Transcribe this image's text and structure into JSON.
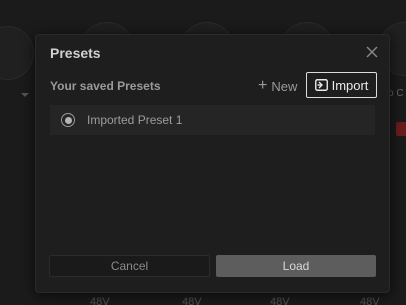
{
  "dialog": {
    "title": "Presets",
    "subheader": "Your saved Presets",
    "new_label": "New",
    "import_label": "Import",
    "presets": [
      {
        "label": "Imported Preset 1",
        "selected": true
      }
    ],
    "cancel_label": "Cancel",
    "load_label": "Load"
  },
  "background": {
    "phantom_labels": [
      "48V",
      "48V",
      "48V",
      "48V"
    ]
  },
  "colors": {
    "dialog_bg": "#1e1e1e",
    "item_bg": "#252525",
    "load_bg": "#5d5d5d",
    "import_border": "#dcdcdc"
  }
}
